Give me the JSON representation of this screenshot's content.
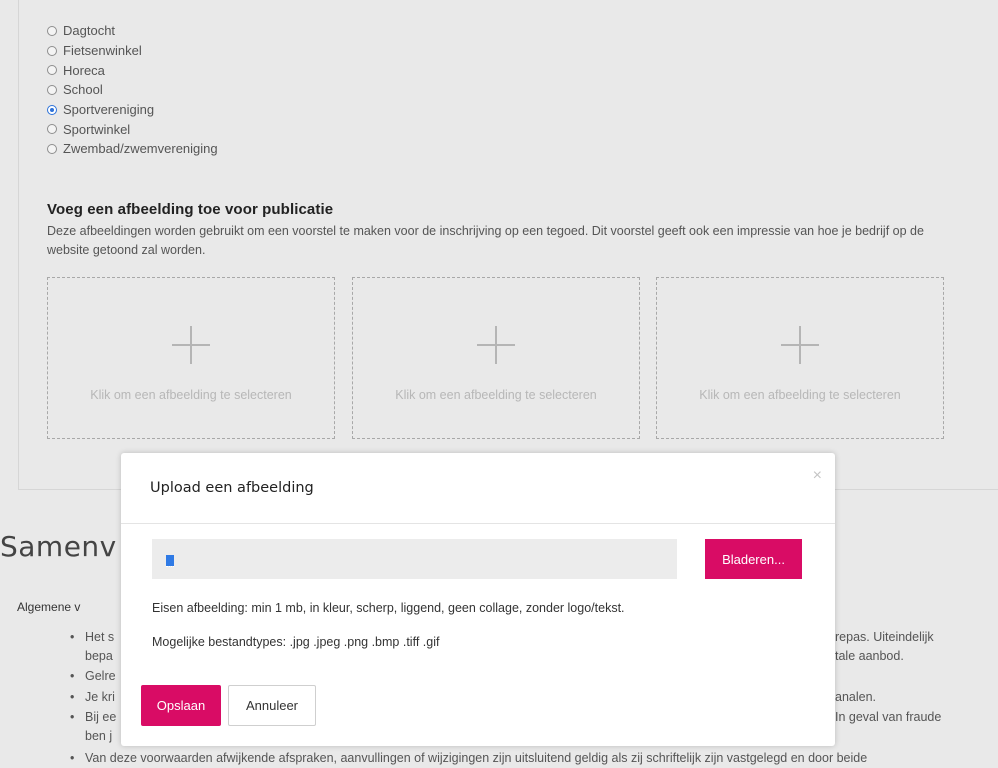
{
  "category_options": [
    {
      "label": "Dagtocht",
      "checked": false
    },
    {
      "label": "Fietsenwinkel",
      "checked": false
    },
    {
      "label": "Horeca",
      "checked": false
    },
    {
      "label": "School",
      "checked": false
    },
    {
      "label": "Sportvereniging",
      "checked": true
    },
    {
      "label": "Sportwinkel",
      "checked": false
    },
    {
      "label": "Zwembad/zwemvereniging",
      "checked": false
    }
  ],
  "image_section": {
    "heading": "Voeg een afbeelding toe voor publicatie",
    "description": "Deze afbeeldingen worden gebruikt om een voorstel te maken voor de inschrijving op een tegoed. Dit voorstel geeft ook een impressie van hoe je bedrijf op de website getoond zal worden.",
    "upload_slots": [
      {
        "label": "Klik om een afbeelding te selecteren"
      },
      {
        "label": "Klik om een afbeelding te selecteren"
      },
      {
        "label": "Klik om een afbeelding te selecteren"
      }
    ]
  },
  "summary": {
    "heading_visible": "Samenv",
    "sub_label_visible": "Algemene v",
    "bullets_left": [
      "Het s",
      "bepa",
      "Gelre",
      "Je kri",
      "Bij ee",
      "ben j"
    ],
    "bullets_right": [
      "repas. Uiteindelijk",
      "tale aanbod.",
      "",
      "analen.",
      "In geval van fraude",
      ""
    ],
    "bottom_line": "Van deze voorwaarden afwijkende afspraken, aanvullingen of wijzigingen zijn uitsluitend geldig als zij schriftelijk zijn vastgelegd en door beide"
  },
  "modal": {
    "title": "Upload een afbeelding",
    "close_symbol": "×",
    "browse_label": "Bladeren...",
    "requirements": "Eisen afbeelding: min 1 mb, in kleur, scherp, liggend, geen collage, zonder logo/tekst.",
    "filetypes": "Mogelijke bestandtypes: .jpg .jpeg .png .bmp .tiff .gif",
    "save_label": "Opslaan",
    "cancel_label": "Annuleer"
  },
  "colors": {
    "accent": "#d90c65",
    "radio_checked": "#2d72d9"
  }
}
